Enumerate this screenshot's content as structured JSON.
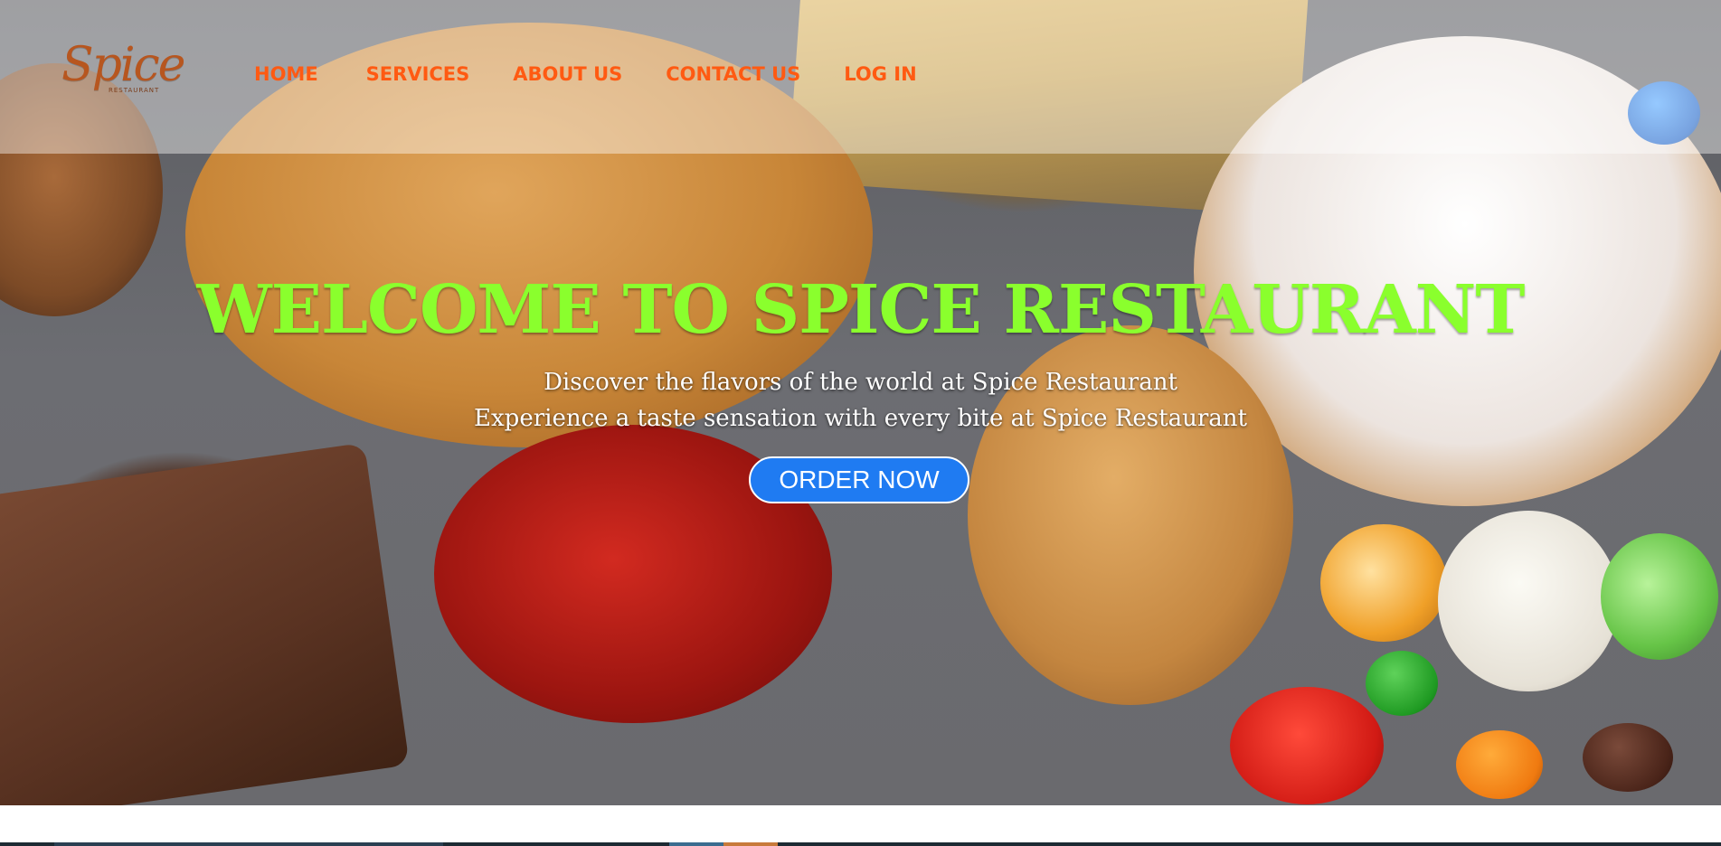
{
  "brand": {
    "logo_text": "Spice",
    "logo_sub": "RESTAURANT"
  },
  "nav": {
    "items": [
      {
        "label": "HOME"
      },
      {
        "label": "SERVICES"
      },
      {
        "label": "ABOUT US"
      },
      {
        "label": "CONTACT US"
      },
      {
        "label": "LOG IN"
      }
    ]
  },
  "hero": {
    "headline": "WELCOME TO SPICE RESTAURANT",
    "subtitle_1": "Discover the flavors of the world at Spice Restaurant",
    "subtitle_2": "Experience a taste sensation with every bite at Spice Restaurant",
    "cta_label": "ORDER NOW"
  },
  "colors": {
    "nav_text": "#ff5a12",
    "headline": "#8aff2d",
    "cta_bg": "#1f7bf2",
    "logo": "#b7561f"
  },
  "icons": {
    "hero_image": "food-spread-image"
  }
}
